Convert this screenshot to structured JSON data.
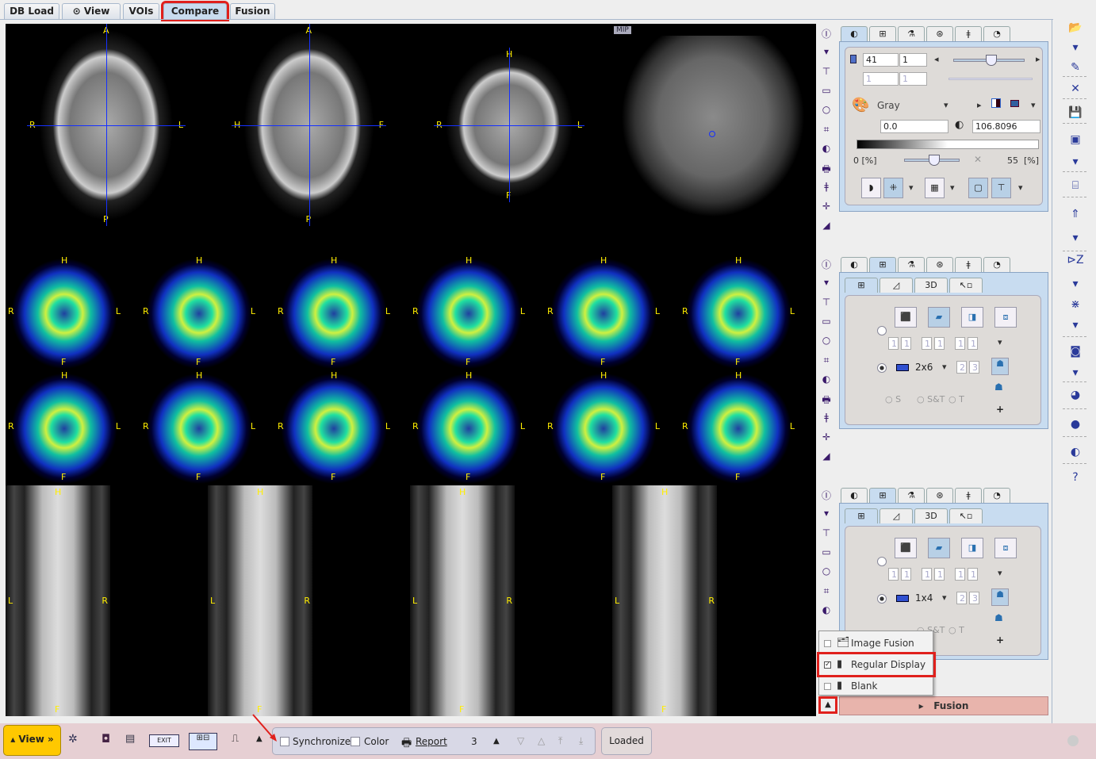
{
  "tabs": [
    {
      "label": "DB Load"
    },
    {
      "label": "View",
      "icon": "eye-icon"
    },
    {
      "label": "VOIs"
    },
    {
      "label": "Compare",
      "active": true
    },
    {
      "label": "Fusion"
    }
  ],
  "viewer": {
    "row1": [
      {
        "labels": {
          "top": "A",
          "bottom": "P",
          "left": "R",
          "right": "L"
        },
        "kind": "mri-axial"
      },
      {
        "labels": {
          "top": "A",
          "bottom": "P",
          "left": "H",
          "right": "F"
        },
        "kind": "mri-sagittal"
      },
      {
        "labels": {
          "top": "H",
          "bottom": "F",
          "left": "R",
          "right": "L"
        },
        "kind": "mri-coronal"
      },
      {
        "badge": "MIP",
        "kind": "mri-mip"
      }
    ],
    "pet_labels": {
      "top": "H",
      "bottom": "F",
      "left": "R",
      "right": "L"
    },
    "pet_count": 12,
    "ct_labels": {
      "top": "H",
      "bottom": "F",
      "left": "L",
      "right": "R"
    },
    "ct_count": 4
  },
  "panel1": {
    "slice": "41",
    "slice_step": "1",
    "frame": "1",
    "frame_step": "1",
    "colortable": "Gray",
    "min": "0.0",
    "max": "106.8096",
    "lower_pct": "0",
    "upper_pct": "55",
    "pct_unit": "[%]"
  },
  "panel2": {
    "layout": "2x6",
    "row": "2",
    "col": "3",
    "fields": [
      "1",
      "1",
      "1",
      "1",
      "1",
      "1"
    ],
    "subtab3d": "3D",
    "mode_options": [
      "S",
      "S&T",
      "T"
    ]
  },
  "panel3": {
    "layout": "1x4",
    "row": "2",
    "col": "3",
    "fields": [
      "1",
      "1",
      "1",
      "1",
      "1",
      "1"
    ],
    "subtab3d": "3D",
    "mode_options": [
      "S&T",
      "T"
    ]
  },
  "popup_menu": [
    {
      "label": "Image Fusion",
      "checked": false
    },
    {
      "label": "Regular Display",
      "checked": true
    },
    {
      "label": "Blank",
      "checked": false
    }
  ],
  "fusion_bar": {
    "label": "Fusion"
  },
  "bottom": {
    "view_label": "View »",
    "synchronize": "Synchronize",
    "color": "Color",
    "report": "Report",
    "count": "3",
    "status": "Loaded",
    "exit": "EXIT"
  },
  "colors": {
    "accent_highlight": "#e0201c",
    "crosshair": "#1530ff",
    "orientation": "#ffee00",
    "view_button": "#ffc800"
  }
}
